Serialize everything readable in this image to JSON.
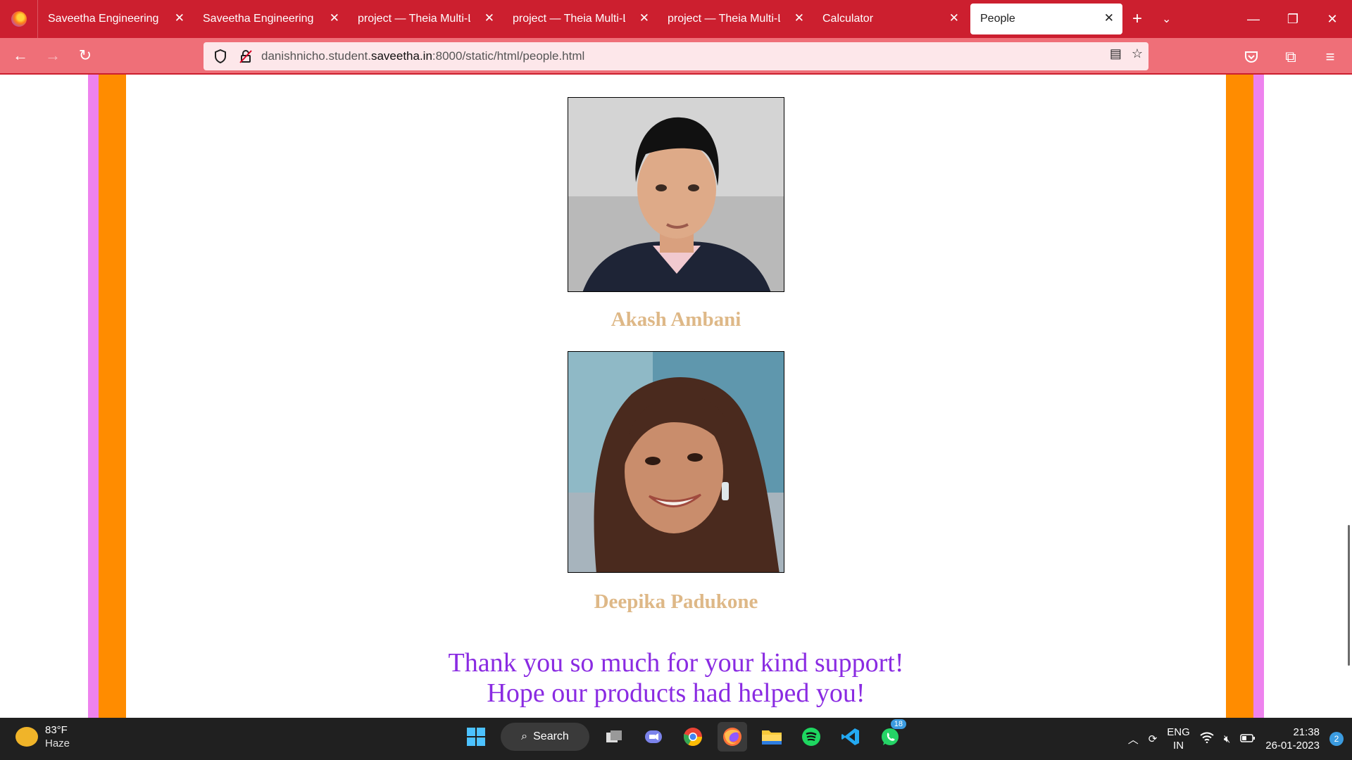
{
  "browser": {
    "tabs": [
      {
        "title": "Saveetha Engineering College"
      },
      {
        "title": "Saveetha Engineering College"
      },
      {
        "title": "project — Theia Multi-Language"
      },
      {
        "title": "project — Theia Multi-Language"
      },
      {
        "title": "project — Theia Multi-Language"
      },
      {
        "title": "Calculator"
      },
      {
        "title": "People",
        "active": true
      }
    ],
    "url_prefix": "danishnicho.student.",
    "url_domain": "saveetha.in",
    "url_suffix": ":8000/static/html/people.html"
  },
  "page": {
    "people": [
      {
        "name": "Akash Ambani"
      },
      {
        "name": "Deepika Padukone"
      }
    ],
    "thanks_line1": "Thank you so much for your kind support!",
    "thanks_line2": "Hope our products had helped you!",
    "colors": {
      "name": "#deb887",
      "thanks": "#8a2be2",
      "orange": "#ff8c00",
      "violet": "#ee82ee"
    }
  },
  "taskbar": {
    "weather_temp": "83°F",
    "weather_cond": "Haze",
    "search_label": "Search",
    "whatsapp_badge": "18",
    "lang_line1": "ENG",
    "lang_line2": "IN",
    "time": "21:38",
    "date": "26-01-2023",
    "notifications": "2"
  }
}
